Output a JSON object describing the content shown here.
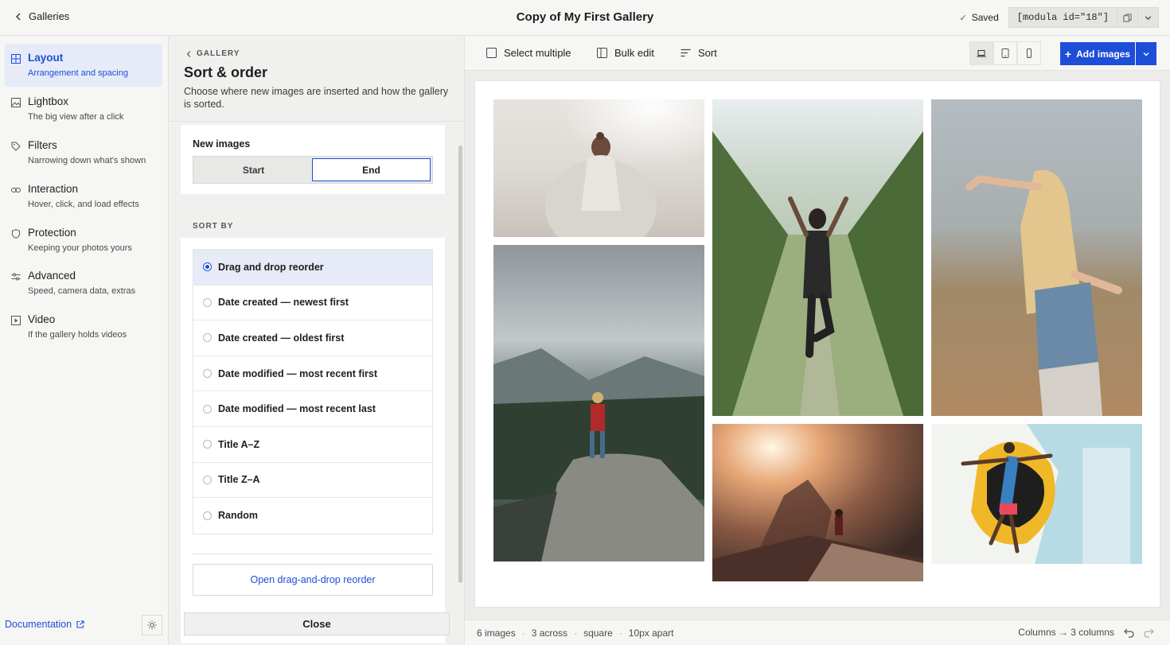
{
  "topbar": {
    "back_label": "Galleries",
    "title": "Copy of My First Gallery",
    "saved_label": "Saved",
    "shortcode": "[modula id=\"18\"]"
  },
  "nav": {
    "items": [
      {
        "label": "Layout",
        "sub": "Arrangement and spacing"
      },
      {
        "label": "Lightbox",
        "sub": "The big view after a click"
      },
      {
        "label": "Filters",
        "sub": "Narrowing down what's shown"
      },
      {
        "label": "Interaction",
        "sub": "Hover, click, and load effects"
      },
      {
        "label": "Protection",
        "sub": "Keeping your photos yours"
      },
      {
        "label": "Advanced",
        "sub": "Speed, camera data, extras"
      },
      {
        "label": "Video",
        "sub": "If the gallery holds videos"
      }
    ],
    "active_index": 0,
    "documentation_label": "Documentation"
  },
  "panel": {
    "crumb": "GALLERY",
    "title": "Sort & order",
    "description": "Choose where new images are inserted and how the gallery is sorted.",
    "new_images_label": "New images",
    "new_images_options": [
      "Start",
      "End"
    ],
    "new_images_selected": "End",
    "sort_by_label": "SORT BY",
    "sort_options": [
      "Drag and drop reorder",
      "Date created — newest first",
      "Date created — oldest first",
      "Date modified — most recent first",
      "Date modified — most recent last",
      "Title A–Z",
      "Title Z–A",
      "Random"
    ],
    "sort_selected": "Drag and drop reorder",
    "open_reorder_label": "Open drag-and-drop reorder",
    "close_label": "Close"
  },
  "toolbar": {
    "select_multiple": "Select multiple",
    "bulk_edit": "Bulk edit",
    "sort": "Sort",
    "add_images": "Add images",
    "active_device": "desktop"
  },
  "footer": {
    "stats": [
      "6 images",
      "3 across",
      "square",
      "10px apart"
    ],
    "history_label": "Columns → 3 columns"
  },
  "colors": {
    "accent": "#1d4ed8",
    "active_bg": "#e6ebf7"
  }
}
